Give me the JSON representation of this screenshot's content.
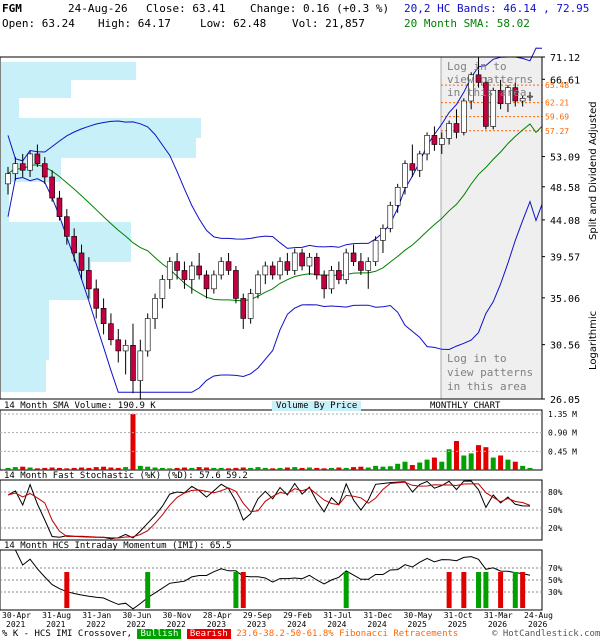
{
  "header": {
    "ticker": "FGM",
    "date": "24-Aug-26",
    "close_label": "Close: 63.41",
    "change_label": "Change: 0.16 (+0.3 %)",
    "open_label": "Open: 63.24",
    "high_label": "High: 64.17",
    "low_label": "Low: 62.48",
    "vol_label": "Vol: 21,857",
    "bands_label": "20,2 HC Bands: 46.14 , 72.95",
    "sma_label": "20 Month SMA: 58.02"
  },
  "colors": {
    "band": "#1010c8",
    "sma": "#008000",
    "up": "#ffffff",
    "down": "#c00040",
    "vbp": "#c8f0f8",
    "fib": "#ff6600"
  },
  "main": {
    "right_axis_title": "Split and Dividend Adjusted",
    "log_label": "Logarithmic",
    "pattern_text": [
      "Log in to",
      "view patterns",
      "in this area"
    ],
    "fib_levels": [
      "65.48",
      "62.21",
      "59.69",
      "57.27"
    ]
  },
  "chart_data": {
    "type": "candlestick",
    "scale": "log",
    "ylim": [
      26.05,
      71.12
    ],
    "y_ticks": [
      "71.12",
      "66.61",
      "53.09",
      "48.58",
      "44.08",
      "39.57",
      "35.06",
      "30.56",
      "26.05"
    ],
    "x_tick_labels": [
      "30-Apr\n2021",
      "31-Aug\n2021",
      "31-Jan\n2022",
      "30-Jun\n2022",
      "30-Nov\n2022",
      "28-Apr\n2023",
      "29-Sep\n2023",
      "29-Feb\n2024",
      "31-Jul\n2024",
      "31-Dec\n2024",
      "30-May\n2025",
      "31-Oct\n2025",
      "31-Mar\n2026",
      "24-Aug\n2026"
    ],
    "candles": [
      [
        49.0,
        51.5,
        47.5,
        50.5
      ],
      [
        50.5,
        53.0,
        49.5,
        52.0
      ],
      [
        52.0,
        53.5,
        50.0,
        51.0
      ],
      [
        51.0,
        54.0,
        50.0,
        53.5
      ],
      [
        53.5,
        55.0,
        51.5,
        52.0
      ],
      [
        52.0,
        53.0,
        49.0,
        50.0
      ],
      [
        50.0,
        51.0,
        46.5,
        47.0
      ],
      [
        47.0,
        48.0,
        44.0,
        44.5
      ],
      [
        44.5,
        45.5,
        41.0,
        42.0
      ],
      [
        42.0,
        43.0,
        39.0,
        40.0
      ],
      [
        40.0,
        41.0,
        37.0,
        38.0
      ],
      [
        38.0,
        39.5,
        35.0,
        36.0
      ],
      [
        36.0,
        37.0,
        33.0,
        34.0
      ],
      [
        34.0,
        35.0,
        31.5,
        32.5
      ],
      [
        32.5,
        33.5,
        30.5,
        31.0
      ],
      [
        31.0,
        32.0,
        29.0,
        30.0
      ],
      [
        30.0,
        31.0,
        28.0,
        30.5
      ],
      [
        30.5,
        32.5,
        26.5,
        27.5
      ],
      [
        27.5,
        31.0,
        26.0,
        30.0
      ],
      [
        30.0,
        33.5,
        29.5,
        33.0
      ],
      [
        33.0,
        35.5,
        32.0,
        35.0
      ],
      [
        35.0,
        37.5,
        34.0,
        37.0
      ],
      [
        37.0,
        39.5,
        36.0,
        39.0
      ],
      [
        39.0,
        40.0,
        37.0,
        38.0
      ],
      [
        38.0,
        39.0,
        36.0,
        37.0
      ],
      [
        37.0,
        39.0,
        35.5,
        38.5
      ],
      [
        38.5,
        40.0,
        37.0,
        37.5
      ],
      [
        37.5,
        38.0,
        35.0,
        36.0
      ],
      [
        36.0,
        38.0,
        35.5,
        37.5
      ],
      [
        37.5,
        39.5,
        37.0,
        39.0
      ],
      [
        39.0,
        40.0,
        37.5,
        38.0
      ],
      [
        38.0,
        38.5,
        34.5,
        35.0
      ],
      [
        35.0,
        35.5,
        32.0,
        33.0
      ],
      [
        33.0,
        36.0,
        32.5,
        35.5
      ],
      [
        35.5,
        38.0,
        35.0,
        37.5
      ],
      [
        37.5,
        39.0,
        36.5,
        38.5
      ],
      [
        38.5,
        39.0,
        37.0,
        37.5
      ],
      [
        37.5,
        39.5,
        37.0,
        39.0
      ],
      [
        39.0,
        40.0,
        37.5,
        38.0
      ],
      [
        38.0,
        40.5,
        37.5,
        40.0
      ],
      [
        40.0,
        40.5,
        38.0,
        38.5
      ],
      [
        38.5,
        40.0,
        37.5,
        39.5
      ],
      [
        39.5,
        40.0,
        37.0,
        37.5
      ],
      [
        37.5,
        38.0,
        35.0,
        36.0
      ],
      [
        36.0,
        38.5,
        35.5,
        38.0
      ],
      [
        38.0,
        39.0,
        36.5,
        37.0
      ],
      [
        37.0,
        40.5,
        36.5,
        40.0
      ],
      [
        40.0,
        41.0,
        38.5,
        39.0
      ],
      [
        39.0,
        40.0,
        37.5,
        38.0
      ],
      [
        38.0,
        39.5,
        36.0,
        39.0
      ],
      [
        39.0,
        42.0,
        38.5,
        41.5
      ],
      [
        41.5,
        43.5,
        40.0,
        43.0
      ],
      [
        43.0,
        46.5,
        42.5,
        46.0
      ],
      [
        46.0,
        49.0,
        45.0,
        48.5
      ],
      [
        48.5,
        52.5,
        47.5,
        52.0
      ],
      [
        52.0,
        55.0,
        50.0,
        51.0
      ],
      [
        51.0,
        54.0,
        50.0,
        53.5
      ],
      [
        53.5,
        57.0,
        52.5,
        56.5
      ],
      [
        56.5,
        58.0,
        54.0,
        55.0
      ],
      [
        55.0,
        57.0,
        53.5,
        56.0
      ],
      [
        56.0,
        59.0,
        55.0,
        58.5
      ],
      [
        58.5,
        61.0,
        56.0,
        57.0
      ],
      [
        57.0,
        63.0,
        56.5,
        62.5
      ],
      [
        62.5,
        68.0,
        61.0,
        67.5
      ],
      [
        67.5,
        71.0,
        65.0,
        66.0
      ],
      [
        66.0,
        67.0,
        57.5,
        58.0
      ],
      [
        58.0,
        65.0,
        57.5,
        64.5
      ],
      [
        64.5,
        66.5,
        61.0,
        62.0
      ],
      [
        62.0,
        65.5,
        60.5,
        65.0
      ],
      [
        65.0,
        66.0,
        61.5,
        62.5
      ],
      [
        62.5,
        63.5,
        61.5,
        63.0
      ],
      [
        63.24,
        64.17,
        62.48,
        63.41
      ]
    ],
    "volume_title": "14 Month SMA Volume: 190.9 K",
    "volume_by_price_label": "Volume By Price",
    "period_label": "MONTHLY CHART",
    "volume_ticks": [
      "1.35 M",
      "0.90 M",
      "0.45 M"
    ],
    "stoch_title": "14 Month Fast Stochastic (%K) (%D): 57.6  59.2",
    "stoch_ticks": [
      "80%",
      "50%",
      "20%"
    ],
    "imi_title": "14 Month HCS Intraday Momentum (IMI): 65.5",
    "imi_ticks": [
      "70%",
      "50%",
      "30%"
    ]
  },
  "footer": {
    "legend_prefix": "% K - HCS IMI Crossover,",
    "bullish": "Bullish",
    "bearish": "Bearish",
    "fib_text": "23.6-38.2-50-61.8% Fibonacci Retracements",
    "copyright": "© HotCandlestick.com"
  }
}
